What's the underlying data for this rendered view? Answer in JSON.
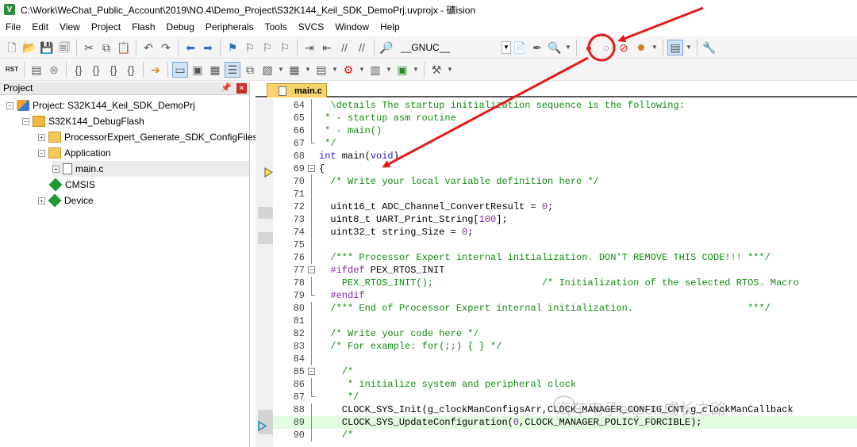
{
  "window": {
    "title": "C:\\Work\\WeChat_Public_Account\\2019\\NO.4\\Demo_Project\\S32K144_Keil_SDK_DemoPrj.uvprojx - 礦ision"
  },
  "menu": [
    "File",
    "Edit",
    "View",
    "Project",
    "Flash",
    "Debug",
    "Peripherals",
    "Tools",
    "SVCS",
    "Window",
    "Help"
  ],
  "toolbar": {
    "define_combo_value": "__GNUC__"
  },
  "project_panel": {
    "title": "Project",
    "tree": {
      "project": "Project: S32K144_Keil_SDK_DemoPrj",
      "target": "S32K144_DebugFlash",
      "group1": "ProcessorExpert_Generate_SDK_ConfigFiles",
      "group2": "Application",
      "file": "main.c",
      "cmsis": "CMSIS",
      "device": "Device"
    }
  },
  "editor": {
    "tab": "main.c",
    "lines": [
      {
        "n": "64",
        "segs": [
          [
            "cm",
            "  \\details The startup initialization sequence is the following:"
          ]
        ]
      },
      {
        "n": "65",
        "segs": [
          [
            "cm",
            " * - startup asm routine"
          ]
        ]
      },
      {
        "n": "66",
        "segs": [
          [
            "cm",
            " * - main()"
          ]
        ]
      },
      {
        "n": "67",
        "segs": [
          [
            "cm",
            " */"
          ]
        ]
      },
      {
        "n": "68",
        "segs": [
          [
            "kw",
            "int"
          ],
          [
            "txt",
            " main("
          ],
          [
            "kw",
            "void"
          ],
          [
            "txt",
            ")"
          ]
        ]
      },
      {
        "n": "69",
        "segs": [
          [
            "txt",
            "{"
          ]
        ]
      },
      {
        "n": "70",
        "segs": [
          [
            "cm",
            "  /* Write your local variable definition here */"
          ]
        ]
      },
      {
        "n": "71",
        "segs": []
      },
      {
        "n": "72",
        "segs": [
          [
            "txt",
            "  uint16_t ADC_Channel_ConvertResult = "
          ],
          [
            "num",
            "0"
          ],
          [
            "txt",
            ";"
          ]
        ]
      },
      {
        "n": "73",
        "segs": [
          [
            "txt",
            "  uint8_t UART_Print_String["
          ],
          [
            "num",
            "100"
          ],
          [
            "txt",
            "];"
          ]
        ]
      },
      {
        "n": "74",
        "segs": [
          [
            "txt",
            "  uint32_t string_Size = "
          ],
          [
            "num",
            "0"
          ],
          [
            "txt",
            ";"
          ]
        ]
      },
      {
        "n": "75",
        "segs": []
      },
      {
        "n": "76",
        "segs": [
          [
            "cm",
            "  /*** Processor Expert internal initialization. DON'T REMOVE THIS CODE!!! ***/"
          ]
        ]
      },
      {
        "n": "77",
        "segs": [
          [
            "pp",
            "  #ifdef"
          ],
          [
            "txt",
            " PEX_RTOS_INIT"
          ]
        ]
      },
      {
        "n": "78",
        "segs": [
          [
            "txt",
            "    "
          ],
          [
            "cm",
            "PEX_RTOS_INIT();                   /* Initialization of the selected RTOS. Macro"
          ]
        ]
      },
      {
        "n": "79",
        "segs": [
          [
            "pp",
            "  #endif"
          ]
        ]
      },
      {
        "n": "80",
        "segs": [
          [
            "cm",
            "  /*** End of Processor Expert internal initialization.                    ***/"
          ]
        ]
      },
      {
        "n": "81",
        "segs": []
      },
      {
        "n": "82",
        "segs": [
          [
            "cm",
            "  /* Write your code here */"
          ]
        ]
      },
      {
        "n": "83",
        "segs": [
          [
            "cm",
            "  /* For example: for(;;) { } */"
          ]
        ]
      },
      {
        "n": "84",
        "segs": []
      },
      {
        "n": "85",
        "segs": [
          [
            "cm",
            "    /*"
          ]
        ]
      },
      {
        "n": "86",
        "segs": [
          [
            "cm",
            "     * initialize system and peripheral clock"
          ]
        ]
      },
      {
        "n": "87",
        "segs": [
          [
            "cm",
            "     */"
          ]
        ]
      },
      {
        "n": "88",
        "segs": [
          [
            "txt",
            "    CLOCK_SYS_Init(g_clockManConfigsArr,CLOCK_MANAGER_CONFIG_CNT,g_clockManCallback"
          ]
        ]
      },
      {
        "n": "89",
        "segs": [
          [
            "txt",
            "    CLOCK_SYS_UpdateConfiguration("
          ],
          [
            "num",
            "0"
          ],
          [
            "txt",
            ",CLOCK_MANAGER_POLICY_FORCIBLE);"
          ]
        ]
      },
      {
        "n": "90",
        "segs": [
          [
            "cm",
            "    /*"
          ]
        ]
      }
    ]
  },
  "watermark": "汽车电子expert成长之路",
  "colors": {
    "annotation_red": "#e31b1b",
    "comment_green": "#148a14",
    "keyword_blue": "#1b1bcf",
    "tab_yellow": "#f6d36b"
  }
}
